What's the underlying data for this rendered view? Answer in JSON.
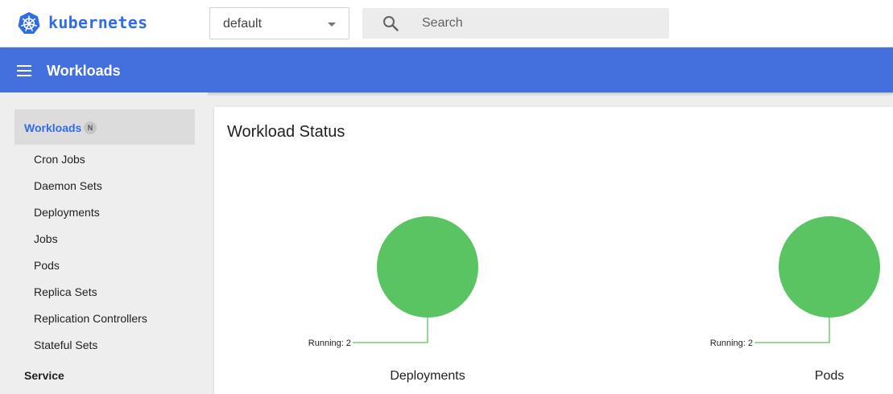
{
  "header": {
    "brand": "kubernetes",
    "namespace": {
      "selected": "default"
    },
    "search": {
      "placeholder": "Search"
    }
  },
  "titlebar": {
    "title": "Workloads"
  },
  "sidebar": {
    "section": {
      "label": "Workloads",
      "badge": "N"
    },
    "items": [
      {
        "label": "Cron Jobs"
      },
      {
        "label": "Daemon Sets"
      },
      {
        "label": "Deployments"
      },
      {
        "label": "Jobs"
      },
      {
        "label": "Pods"
      },
      {
        "label": "Replica Sets"
      },
      {
        "label": "Replication Controllers"
      },
      {
        "label": "Stateful Sets"
      }
    ],
    "next_section": "Service"
  },
  "main": {
    "card_title": "Workload Status"
  },
  "colors": {
    "running": "#5ac463",
    "brand": "#326ce5",
    "titlebar": "#4470de"
  },
  "chart_data": [
    {
      "type": "pie",
      "title": "Deployments",
      "slices": [
        {
          "label": "Running",
          "value": 2
        }
      ]
    },
    {
      "type": "pie",
      "title": "Pods",
      "slices": [
        {
          "label": "Running",
          "value": 2
        }
      ]
    }
  ]
}
